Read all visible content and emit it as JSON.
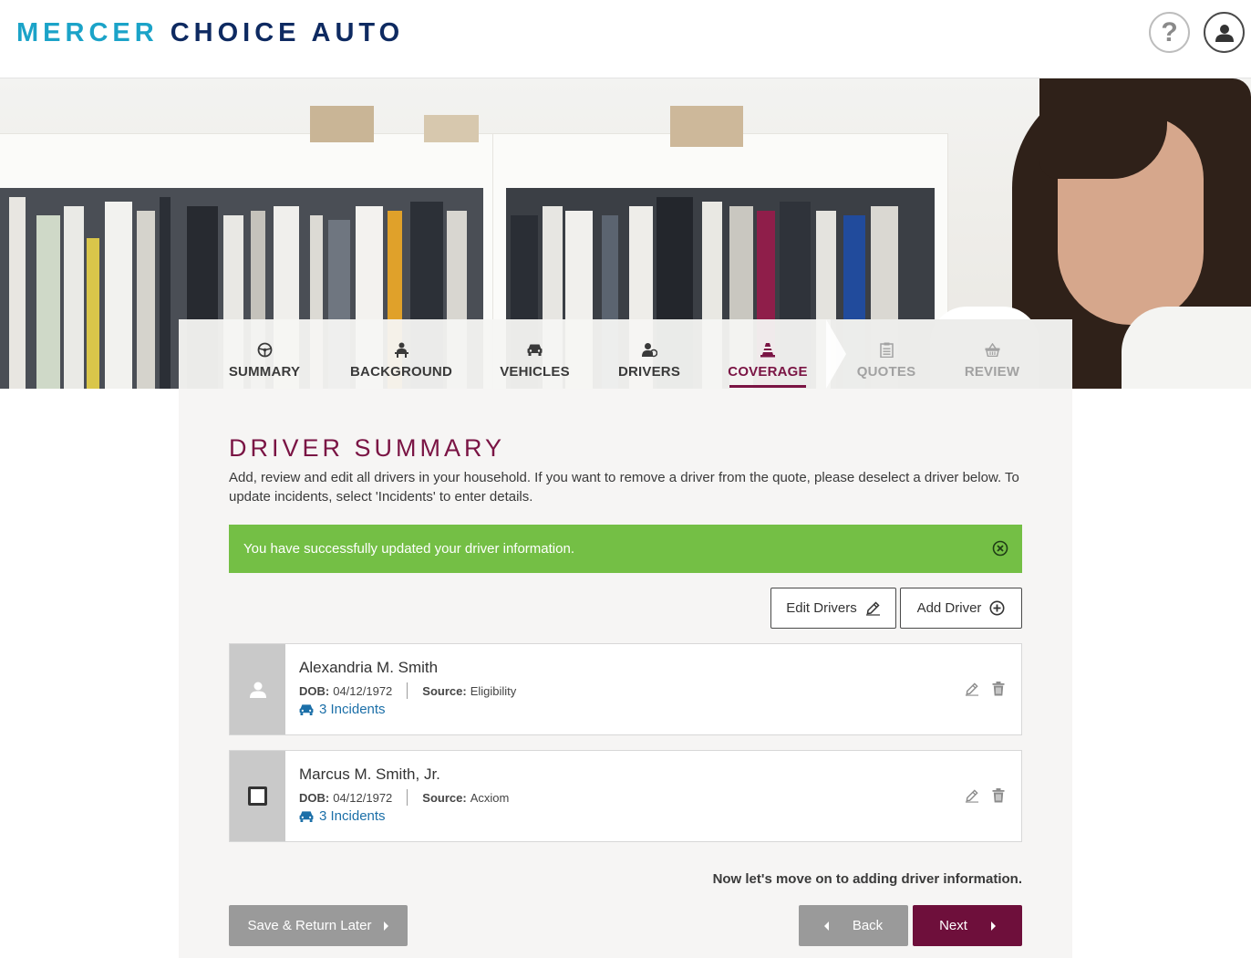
{
  "header": {
    "logo_part1": "MERCER",
    "logo_part2": "CHOICE AUTO",
    "help_icon": "question-mark-icon",
    "user_icon": "user-icon"
  },
  "tabs": [
    {
      "label": "SUMMARY",
      "icon": "steering-wheel-icon",
      "state": "default"
    },
    {
      "label": "BACKGROUND",
      "icon": "person-desk-icon",
      "state": "default"
    },
    {
      "label": "VEHICLES",
      "icon": "car-icon",
      "state": "default"
    },
    {
      "label": "DRIVERS",
      "icon": "driver-icon",
      "state": "default"
    },
    {
      "label": "COVERAGE",
      "icon": "traffic-cone-icon",
      "state": "active"
    },
    {
      "label": "QUOTES",
      "icon": "clipboard-icon",
      "state": "disabled"
    },
    {
      "label": "REVIEW",
      "icon": "basket-icon",
      "state": "disabled"
    }
  ],
  "main": {
    "title": "DRIVER SUMMARY",
    "intro": "Add, review and edit all drivers in your household. If you want to remove a driver from the quote, please deselect a driver below. To update incidents, select 'Incidents' to enter details.",
    "alert": "You have successfully updated your driver information.",
    "edit_drivers_label": "Edit Drivers",
    "add_driver_label": "Add Driver",
    "drivers": [
      {
        "name": "Alexandria M. Smith",
        "dob_label": "DOB:",
        "dob": "04/12/1972",
        "source_label": "Source:",
        "source": "Eligibility",
        "incidents": "3 Incidents",
        "selector": "primary-driver"
      },
      {
        "name": "Marcus M. Smith, Jr.",
        "dob_label": "DOB:",
        "dob": "04/12/1972",
        "source_label": "Source:",
        "source": "Acxiom",
        "incidents": "3 Incidents",
        "selector": "checkbox-unchecked"
      }
    ],
    "next_hint": "Now let's move on to adding driver information.",
    "save_label": "Save & Return Later",
    "back_label": "Back",
    "next_label": "Next"
  },
  "colors": {
    "brand_light": "#1ba3c8",
    "brand_dark": "#0e2a61",
    "accent": "#7a1444",
    "success": "#74bf45",
    "link": "#1b6fa8",
    "button_primary": "#6e0f3b",
    "button_secondary": "#9a9a9a"
  }
}
